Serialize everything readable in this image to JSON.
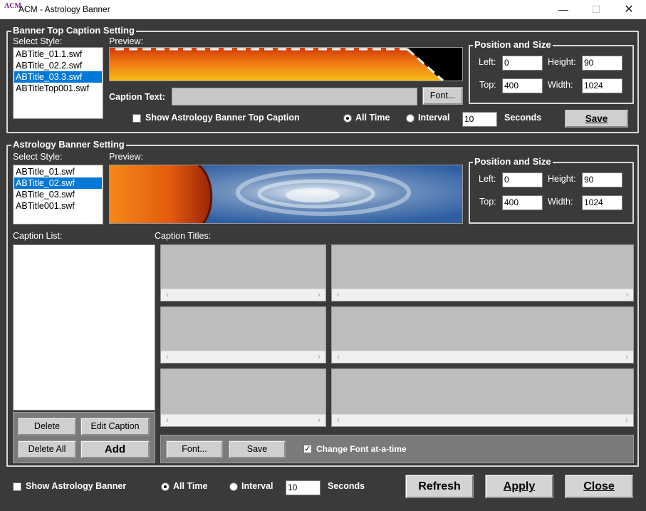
{
  "window": {
    "icon_text": "ACM",
    "title": "ACM - Astrology Banner",
    "min_glyph": "—",
    "max_glyph": "☐",
    "close_glyph": "✕"
  },
  "top_caption": {
    "group_title": "Banner Top Caption Setting",
    "select_style_label": "Select Style:",
    "styles": [
      "ABTitle_01.1.swf",
      "ABTitle_02.2.swf",
      "ABTitle_03.3.swf",
      "ABTitleTop001.swf"
    ],
    "selected_index": 2,
    "preview_label": "Preview:",
    "caption_text_label": "Caption Text:",
    "caption_text_value": "",
    "font_button": "Font...",
    "show_checkbox_label": "Show Astrology Banner Top Caption",
    "show_checked": false,
    "all_time_label": "All Time",
    "interval_label": "Interval",
    "interval_value": "10",
    "seconds_label": "Seconds",
    "save_button": "Save",
    "position": {
      "group_title": "Position and Size",
      "left_label": "Left:",
      "left_value": "0",
      "height_label": "Height:",
      "height_value": "90",
      "top_label": "Top:",
      "top_value": "400",
      "width_label": "Width:",
      "width_value": "1024"
    }
  },
  "banner": {
    "group_title": "Astrology Banner Setting",
    "select_style_label": "Select Style:",
    "styles": [
      "ABTitle_01.swf",
      "ABTitle_02.swf",
      "ABTitle_03.swf",
      "ABTitle001.swf"
    ],
    "selected_index": 1,
    "preview_label": "Preview:",
    "position": {
      "group_title": "Position and Size",
      "left_label": "Left:",
      "left_value": "0",
      "height_label": "Height:",
      "height_value": "90",
      "top_label": "Top:",
      "top_value": "400",
      "width_label": "Width:",
      "width_value": "1024"
    },
    "caption_list_label": "Caption List:",
    "caption_titles_label": "Caption Titles:",
    "delete_button": "Delete",
    "edit_caption_button": "Edit Caption",
    "delete_all_button": "Delete All",
    "add_button": "Add",
    "font_button": "Font...",
    "save_button": "Save",
    "change_font_label": "Change Font at-a-time",
    "change_font_checked": true
  },
  "footer": {
    "show_banner_label": "Show Astrology Banner",
    "all_time_label": "All Time",
    "interval_label": "Interval",
    "interval_value": "10",
    "seconds_label": "Seconds",
    "refresh_button": "Refresh",
    "apply_button": "Apply",
    "close_button": "Close"
  },
  "scroll_glyphs": {
    "left": "‹",
    "right": "›"
  }
}
